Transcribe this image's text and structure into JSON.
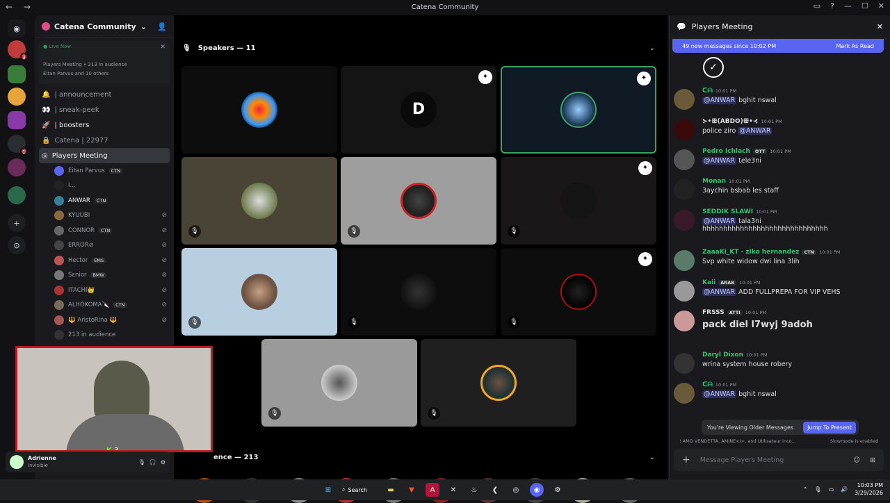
{
  "window": {
    "title": "Catena Community"
  },
  "server": {
    "name": "Catena Community"
  },
  "live_panel": {
    "status": "Live Now",
    "stage": "Players Meeting",
    "audience": "213 in audience",
    "speakers": "Eitan Parvus and 10 others"
  },
  "channels": [
    {
      "icon": "🔔",
      "label": "| announcement",
      "bold": false
    },
    {
      "icon": "👀",
      "label": "| sneak-peek",
      "bold": false
    },
    {
      "icon": "🚀",
      "label": "| boosters",
      "bold": true
    },
    {
      "icon": "🔒",
      "label": "Catena | 22977",
      "bold": false
    },
    {
      "icon": "◎",
      "label": "Players Meeting",
      "bold": true
    }
  ],
  "voice_users": [
    {
      "name": "Eitan Parvus",
      "tag": "CTN"
    },
    {
      "name": "I...",
      "tag": ""
    },
    {
      "name": "ANWAR",
      "tag": "CTN"
    },
    {
      "name": "KYUUBI",
      "tag": ""
    },
    {
      "name": "CONNOR",
      "tag": "CTN"
    },
    {
      "name": "ERROR⊘",
      "tag": ""
    },
    {
      "name": "Hector",
      "tag": "EMS"
    },
    {
      "name": "Sεnior",
      "tag": "BMW"
    },
    {
      "name": "ITACHI👑",
      "tag": ""
    },
    {
      "name": "ALHOKOMA🔪",
      "tag": "CTN"
    },
    {
      "name": "🔱 AristoRina 🔱",
      "tag": ""
    },
    {
      "name": "213 in audience",
      "tag": ""
    }
  ],
  "user_panel": {
    "name": "Adrienne",
    "status": "Invisible"
  },
  "stage": {
    "speakers_header": "Speakers — 11",
    "audience_header": "ence — 213",
    "webcam_badge": "3"
  },
  "chat": {
    "title": "Players Meeting",
    "new_messages": "49 new messages since 10:02 PM",
    "mark_read": "Mark As Read",
    "messages": [
      {
        "name": "ᑕᗩ",
        "color": "#2dc770",
        "time": "10:01 PM",
        "mention": "@ANWAR",
        "text": "bghit nswal",
        "big": false
      },
      {
        "name": "⊱•ꕥ(ABDO)ꕥ•⊰",
        "color": "#dbdee1",
        "time": "10:01 PM",
        "mention": "",
        "text": "police ziro",
        "mention_after": "@ANWAR",
        "big": false
      },
      {
        "name": "Pedro Ichlach",
        "color": "#2dc770",
        "time": "10:01 PM",
        "mention": "@ANWAR",
        "text": "tele3ni",
        "big": false,
        "tag": "ÓTT"
      },
      {
        "name": "Monan",
        "color": "#2dc770",
        "time": "10:01 PM",
        "mention": "",
        "text": "3aychin bsbab les staff",
        "big": false
      },
      {
        "name": "SEDDIK SLAWI",
        "color": "#2dc770",
        "time": "10:01 PM",
        "mention": "@ANWAR",
        "text": "tala3ni",
        "text2": "hhhhhhhhhhhhhhhhhhhhhhhhhhhhhh",
        "big": false
      },
      {
        "name": "ZaaaKi_KT - ziko hernandez",
        "color": "#2dc770",
        "time": "10:01 PM",
        "mention": "",
        "text": "Svp white widow dwi lina 3lih",
        "big": false,
        "tag": "CTN"
      },
      {
        "name": "Kaii",
        "color": "#2dc770",
        "time": "10:01 PM",
        "mention": "@ANWAR",
        "text": "ADD FULLPREPA FOR VIP VEHS",
        "big": false,
        "tag": "ARAB"
      },
      {
        "name": "FRSSS",
        "color": "#dbdee1",
        "time": "10:01 PM",
        "mention": "",
        "text": "pack diel l7wyj 9adoh",
        "big": true,
        "tag": "ATTI"
      },
      {
        "name": "Daryl Dixon",
        "color": "#2dc770",
        "time": "10:01 PM",
        "mention": "",
        "text": "wrina system house robery",
        "big": false
      },
      {
        "name": "ᑕᗩ",
        "color": "#2dc770",
        "time": "10:01 PM",
        "mention": "@ANWAR",
        "text": "bghit nswal",
        "big": false
      }
    ],
    "older_notice": "You're Viewing Older Messages",
    "jump": "Jump To Present",
    "typing": "! AMD VENDETTA, AMINE</>, and Utilisateur inco...",
    "slowmode": "Slowmode is enabled",
    "composer_placeholder": "Message Players Meeting"
  },
  "taskbar": {
    "search": "Search",
    "time": "10:03 PM",
    "date": "3/29/2026"
  }
}
